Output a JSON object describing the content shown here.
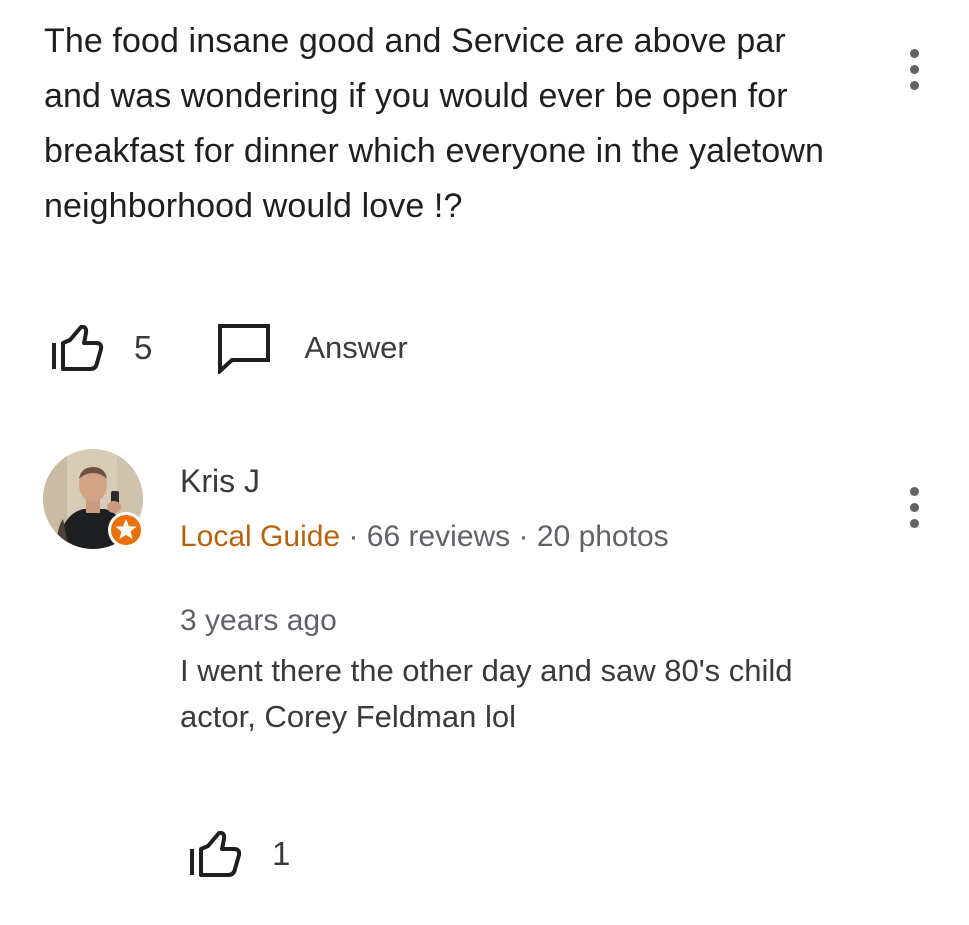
{
  "question": {
    "text": "The food insane good and Service are above par and was wondering if you would ever be open for breakfast for dinner which everyone in the yaletown neighborhood would love !?",
    "like_count": "5",
    "answer_label": "Answer",
    "icons": {
      "like": "thumbs-up-icon",
      "answer": "comment-icon",
      "menu": "more-vert-icon"
    }
  },
  "answer": {
    "author": {
      "name": "Kris J",
      "guide_label": "Local Guide",
      "separator": " · ",
      "reviews": "66 reviews",
      "photos": "20 photos",
      "badge_icon": "local-guide-star-icon"
    },
    "timestamp": "3 years ago",
    "text": "I went there the other day and saw 80's child actor, Corey Feldman lol",
    "like_count": "1",
    "icons": {
      "like": "thumbs-up-icon",
      "menu": "more-vert-icon"
    }
  },
  "colors": {
    "local_guide": "#b8620c",
    "badge": "#e8710a",
    "icon": "#1f1f1f",
    "menu_dots": "#5f6368"
  }
}
